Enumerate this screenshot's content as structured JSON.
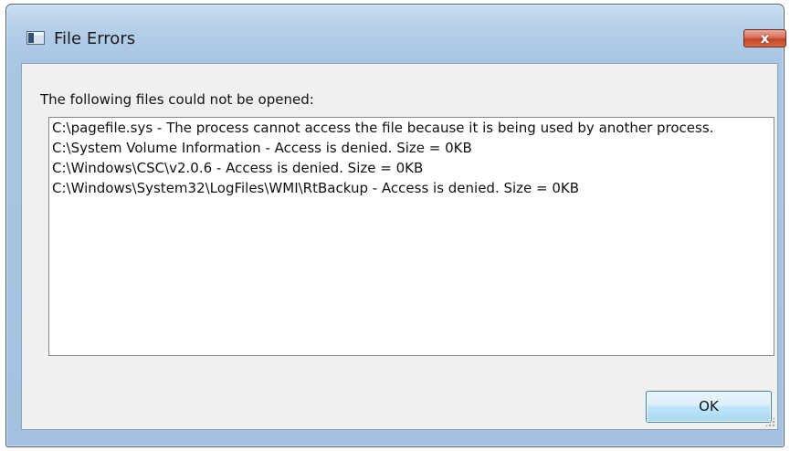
{
  "window": {
    "title": "File Errors",
    "close_label": "x"
  },
  "message": "The following files could not be opened:",
  "errors": [
    "C:\\pagefile.sys - The process cannot access the file because it is being used by another process.",
    "C:\\System Volume Information - Access is denied.  Size = 0KB",
    "C:\\Windows\\CSC\\v2.0.6 - Access is denied.  Size = 0KB",
    "C:\\Windows\\System32\\LogFiles\\WMI\\RtBackup - Access is denied.  Size = 0KB"
  ],
  "buttons": {
    "ok_label": "OK"
  },
  "colors": {
    "title_bar": "#b6d0ea",
    "close_button": "#c3452c",
    "ok_button": "#bee6fd",
    "client_background": "#f0f0f0"
  }
}
